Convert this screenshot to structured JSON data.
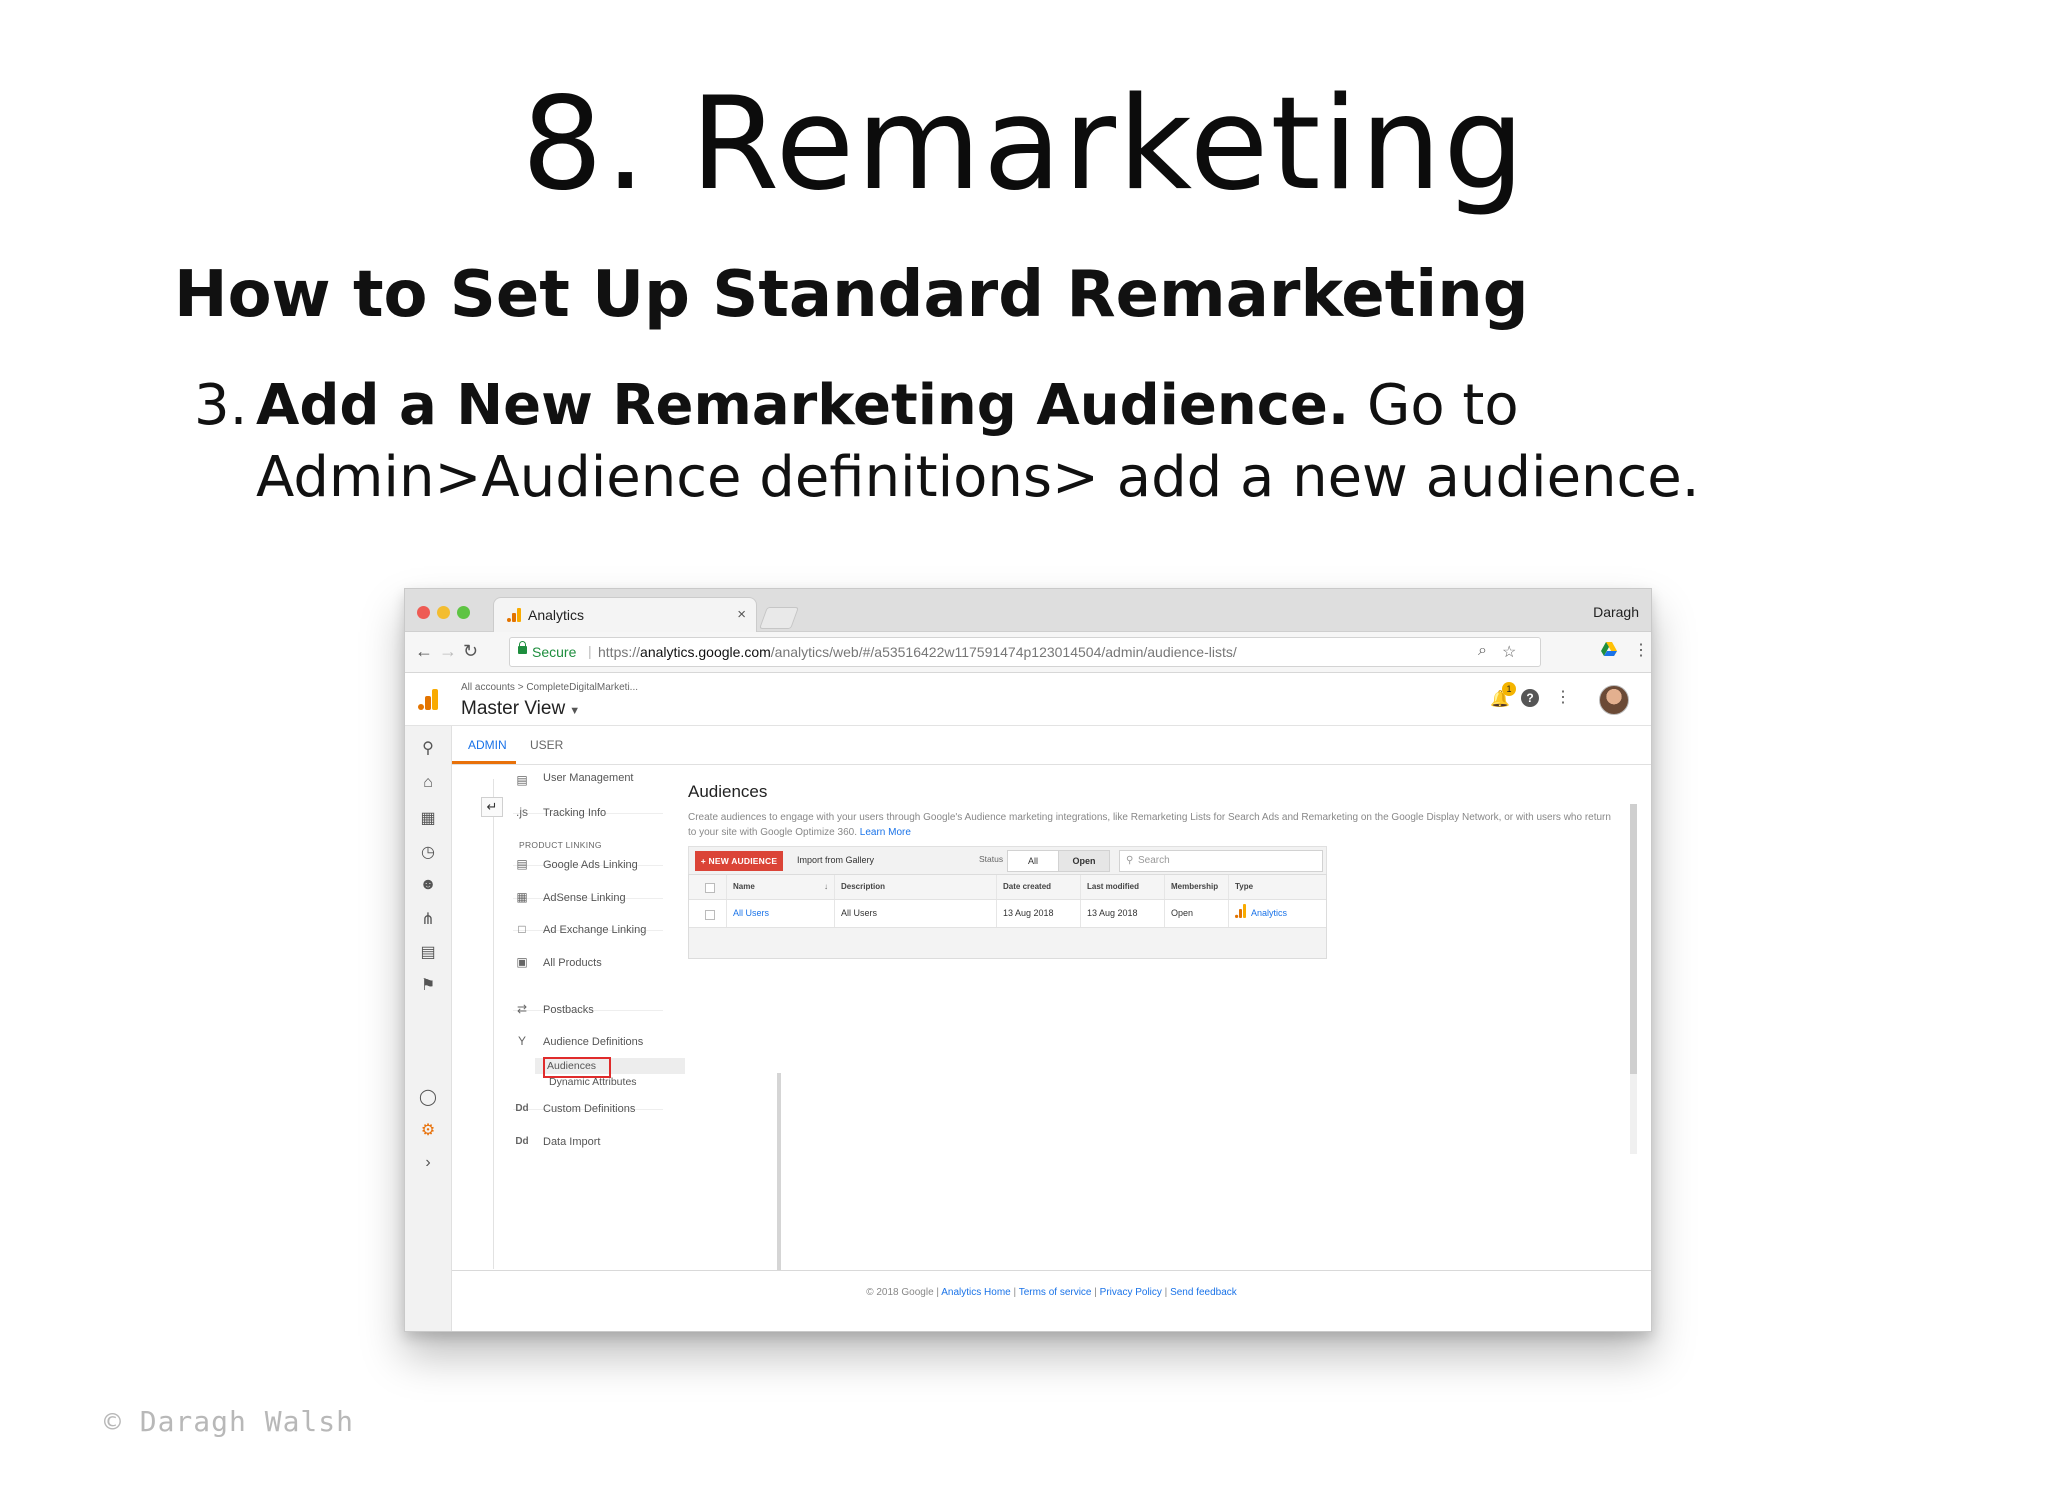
{
  "slide": {
    "title": "8. Remarketing",
    "subtitle": "How to Set Up Standard Remarketing",
    "step_number": "3.",
    "step_bold": "Add a New Remarketing Audience.",
    "step_text": " Go to Admin>Audience definitions> add a new audience.",
    "copyright": "© Daragh Walsh"
  },
  "browser": {
    "tab_title": "Analytics",
    "tab_close": "×",
    "profile_name": "Daragh",
    "secure_label": "Secure",
    "url_scheme": "https://",
    "url_host": "analytics.google.com",
    "url_path": "/analytics/web/#/a53516422w117591474p123014504/admin/audience-lists/"
  },
  "ga_header": {
    "breadcrumb": "All accounts > CompleteDigitalMarketi...",
    "view_name": "Master View",
    "notification_count": "1",
    "help_label": "?"
  },
  "admin_tabs": {
    "admin": "ADMIN",
    "user": "USER"
  },
  "property_menu": {
    "items_top": [
      {
        "label": "User Management",
        "icon": "users-icon"
      },
      {
        "label": "Tracking Info",
        "icon": "js-icon"
      }
    ],
    "section_product_linking": "PRODUCT LINKING",
    "product_items": [
      {
        "label": "Google Ads Linking"
      },
      {
        "label": "AdSense Linking"
      },
      {
        "label": "Ad Exchange Linking"
      },
      {
        "label": "All Products"
      }
    ],
    "postbacks": "Postbacks",
    "audience_definitions": "Audience Definitions",
    "audiences": "Audiences",
    "dynamic_attributes": "Dynamic Attributes",
    "custom_definitions": "Custom Definitions",
    "data_import": "Data Import",
    "dd_label": "Dd",
    "js_label": ".js"
  },
  "audiences": {
    "heading": "Audiences",
    "description": "Create audiences to engage with your users through Google's Audience marketing integrations, like Remarketing Lists for Search Ads and Remarketing on the Google Display Network, or with users who return to your site with Google Optimize 360.",
    "learn_more": "Learn More",
    "new_audience_button": "+ NEW AUDIENCE",
    "import_gallery": "Import from Gallery",
    "status_label": "Status",
    "filter_all": "All",
    "filter_open": "Open",
    "search_placeholder": "Search",
    "columns": [
      "Name",
      "Description",
      "Date created",
      "Last modified",
      "Membership",
      "Type"
    ],
    "rows": [
      {
        "name": "All Users",
        "description": "All Users",
        "date_created": "13 Aug 2018",
        "last_modified": "13 Aug 2018",
        "membership": "Open",
        "type": "Analytics"
      }
    ]
  },
  "footer": {
    "copyright": "© 2018 Google",
    "links": [
      "Analytics Home",
      "Terms of service",
      "Privacy Policy",
      "Send feedback"
    ],
    "separator": " | "
  },
  "colors": {
    "analytics_orange": "#e8710a",
    "link_blue": "#1a73e8",
    "new_audience_red": "#db4437",
    "highlight_red": "#e02b2b",
    "secure_green": "#1e8e3e"
  }
}
